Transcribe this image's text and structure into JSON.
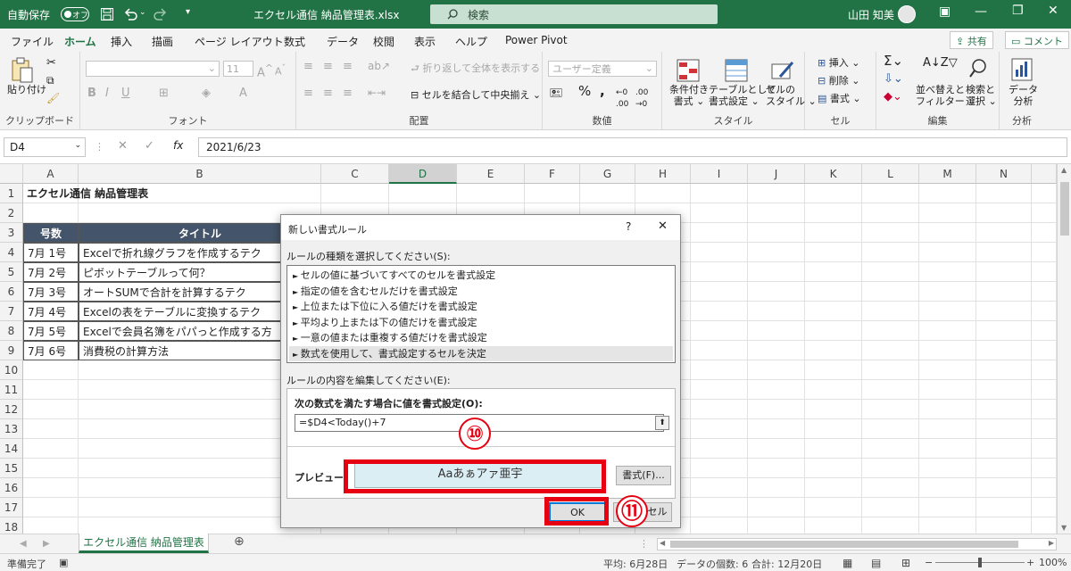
{
  "titlebar": {
    "autosave": "自動保存",
    "autosave_state": "オフ",
    "filename": "エクセル通信 納品管理表.xlsx",
    "search": "検索",
    "user": "山田 知美"
  },
  "tabs": [
    "ファイル",
    "ホーム",
    "挿入",
    "描画",
    "ページ レイアウト",
    "数式",
    "データ",
    "校閲",
    "表示",
    "ヘルプ",
    "Power Pivot"
  ],
  "active_tab": "ホーム",
  "share_label": "共有",
  "comment_label": "コメント",
  "ribbon": {
    "paste": "貼り付け",
    "clipboard": "クリップボード",
    "font": "フォント",
    "font_size": "11",
    "wrap": "折り返して全体を表示する",
    "merge": "セルを結合して中央揃え",
    "alignment": "配置",
    "number_format": "ユーザー定義",
    "number": "数値",
    "cond_format": [
      "条件付き",
      "書式"
    ],
    "table_format": [
      "テーブルとして",
      "書式設定"
    ],
    "cell_style": [
      "セルの",
      "スタイル"
    ],
    "styles": "スタイル",
    "insert": "挿入",
    "delete": "削除",
    "format": "書式",
    "cells": "セル",
    "sort": [
      "並べ替えと",
      "フィルター"
    ],
    "find": [
      "検索と",
      "選択"
    ],
    "editing": "編集",
    "analyze": [
      "データ",
      "分析"
    ],
    "analysis": "分析"
  },
  "formula": {
    "namebox": "D4",
    "fx": "fx",
    "value": "2021/6/23"
  },
  "columns": [
    "A",
    "B",
    "C",
    "D",
    "E",
    "F",
    "G",
    "H",
    "I",
    "J",
    "K",
    "L",
    "M",
    "N"
  ],
  "selected_column": "D",
  "rows": [
    "1",
    "2",
    "3",
    "4",
    "5",
    "6",
    "7",
    "8",
    "9",
    "10",
    "11",
    "12",
    "13",
    "14",
    "15",
    "16",
    "17",
    "18"
  ],
  "sheet": {
    "title": "エクセル通信 納品管理表",
    "headers": [
      "号数",
      "タイトル"
    ],
    "data": [
      [
        "7月 1号",
        "Excelで折れ線グラフを作成するテク"
      ],
      [
        "7月 2号",
        "ピボットテーブルって何？"
      ],
      [
        "7月 3号",
        "オートSUMで合計を計算するテク"
      ],
      [
        "7月 4号",
        "Excelの表をテーブルに変換するテク"
      ],
      [
        "7月 5号",
        "Excelで会員名簿をパパっと作成する方"
      ],
      [
        "7月 6号",
        "消費税の計算方法"
      ]
    ]
  },
  "sheet_tab": "エクセル通信 納品管理表",
  "status": {
    "ready": "準備完了",
    "average": "平均: 6月28日",
    "count": "データの個数: 6",
    "sum": "合計: 12月20日",
    "zoom": "100%"
  },
  "dialog": {
    "title": "新しい書式ルール",
    "help": "?",
    "close": "✕",
    "rule_type_label": "ルールの種類を選択してください(S):",
    "rule_types": [
      "セルの値に基づいてすべてのセルを書式設定",
      "指定の値を含むセルだけを書式設定",
      "上位または下位に入る値だけを書式設定",
      "平均より上または下の値だけを書式設定",
      "一意の値または重複する値だけを書式設定",
      "数式を使用して、書式設定するセルを決定"
    ],
    "edit_label": "ルールの内容を編集してください(E):",
    "formula_label": "次の数式を満たす場合に値を書式設定(O):",
    "formula_value": "=$D4<Today()+7",
    "preview_label": "プレビュー:",
    "preview_text": "Aaあぁアァ亜宇",
    "format_button": "書式(F)...",
    "ok_button": "OK",
    "cancel_button": "キャンセル"
  },
  "annotations": [
    "⑩",
    "⑪"
  ],
  "colors": {
    "excel_green": "#217346",
    "header_fill": "#44546a",
    "highlight_red": "#e60012",
    "preview_fill": "#dbeef4"
  }
}
